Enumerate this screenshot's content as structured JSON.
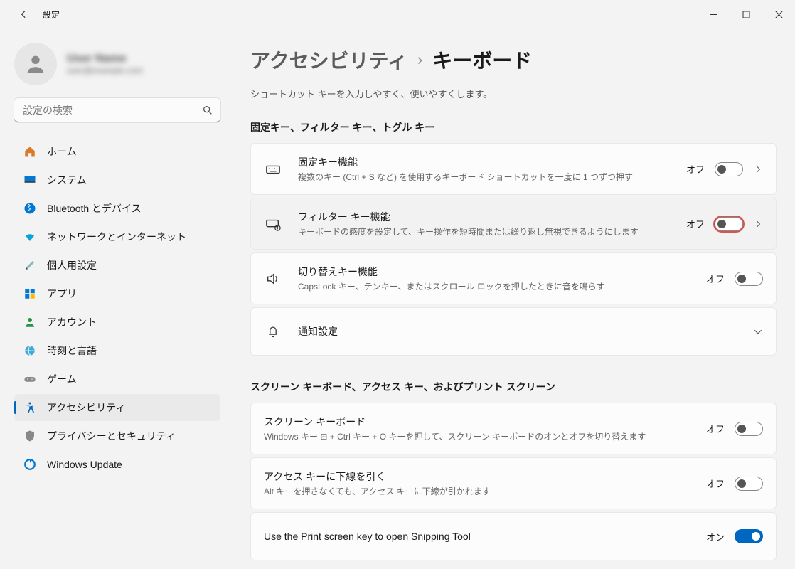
{
  "window": {
    "title": "設定"
  },
  "user": {
    "name": "User Name",
    "sub": "user@example.com"
  },
  "search": {
    "placeholder": "設定の検索"
  },
  "sidebar": {
    "items": [
      {
        "label": "ホーム"
      },
      {
        "label": "システム"
      },
      {
        "label": "Bluetooth とデバイス"
      },
      {
        "label": "ネットワークとインターネット"
      },
      {
        "label": "個人用設定"
      },
      {
        "label": "アプリ"
      },
      {
        "label": "アカウント"
      },
      {
        "label": "時刻と言語"
      },
      {
        "label": "ゲーム"
      },
      {
        "label": "アクセシビリティ"
      },
      {
        "label": "プライバシーとセキュリティ"
      },
      {
        "label": "Windows Update"
      }
    ],
    "active_index": 9
  },
  "breadcrumb": {
    "parent": "アクセシビリティ",
    "sep": "›",
    "current": "キーボード"
  },
  "subtitle": "ショートカット キーを入力しやすく、使いやすくします。",
  "section1": {
    "title": "固定キー、フィルター キー、トグル キー",
    "items": [
      {
        "title": "固定キー機能",
        "desc": "複数のキー (Ctrl + S など) を使用するキーボード ショートカットを一度に 1 つずつ押す",
        "state": "オフ",
        "on": false,
        "chevron": true
      },
      {
        "title": "フィルター キー機能",
        "desc": "キーボードの感度を設定して、キー操作を短時間または繰り返し無視できるようにします",
        "state": "オフ",
        "on": false,
        "chevron": true,
        "highlight": true
      },
      {
        "title": "切り替えキー機能",
        "desc": "CapsLock キー、テンキー、またはスクロール ロックを押したときに音を鳴らす",
        "state": "オフ",
        "on": false,
        "chevron": false
      },
      {
        "title": "通知設定",
        "desc": "",
        "state": "",
        "chevron_down": true
      }
    ]
  },
  "section2": {
    "title": "スクリーン キーボード、アクセス キー、およびプリント スクリーン",
    "items": [
      {
        "title": "スクリーン キーボード",
        "desc": "Windows キー ⊞ + Ctrl キー + O キーを押して、スクリーン キーボードのオンとオフを切り替えます",
        "state": "オフ",
        "on": false
      },
      {
        "title": "アクセス キーに下線を引く",
        "desc": "Alt キーを押さなくても、アクセス キーに下線が引かれます",
        "state": "オフ",
        "on": false
      },
      {
        "title": "Use the Print screen key to open Snipping Tool",
        "desc": "",
        "state": "オン",
        "on": true
      }
    ]
  }
}
